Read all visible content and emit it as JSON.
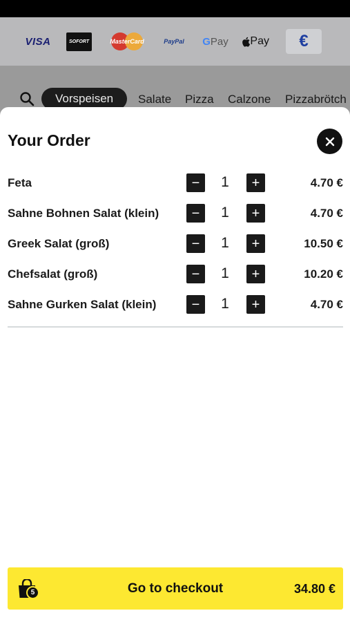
{
  "payment_methods": {
    "visa": "VISA",
    "sofort": "SOFORT",
    "mastercard": "MasterCard",
    "paypal": "PayPal",
    "gpay_g": "G",
    "gpay_pay": "Pay",
    "applepay": "Pay",
    "euro": "€"
  },
  "categories": {
    "active": "Vorspeisen",
    "items": [
      "Salate",
      "Pizza",
      "Calzone",
      "Pizzabrötch"
    ]
  },
  "order": {
    "title": "Your Order",
    "items": [
      {
        "name": "Feta",
        "qty": "1",
        "price": "4.70 €"
      },
      {
        "name": "Sahne Bohnen Salat (klein)",
        "qty": "1",
        "price": "4.70 €"
      },
      {
        "name": "Greek Salat (groß)",
        "qty": "1",
        "price": "10.50 €"
      },
      {
        "name": "Chefsalat (groß)",
        "qty": "1",
        "price": "10.20 €"
      },
      {
        "name": "Sahne Gurken Salat (klein)",
        "qty": "1",
        "price": "4.70 €"
      }
    ],
    "minus_symbol": "−",
    "plus_symbol": "+"
  },
  "checkout": {
    "label": "Go to checkout",
    "total": "34.80 €",
    "bag_count": "5"
  },
  "colors": {
    "accent_yellow": "#fde831",
    "dark": "#111111",
    "overlay": "#9c9c9c"
  }
}
